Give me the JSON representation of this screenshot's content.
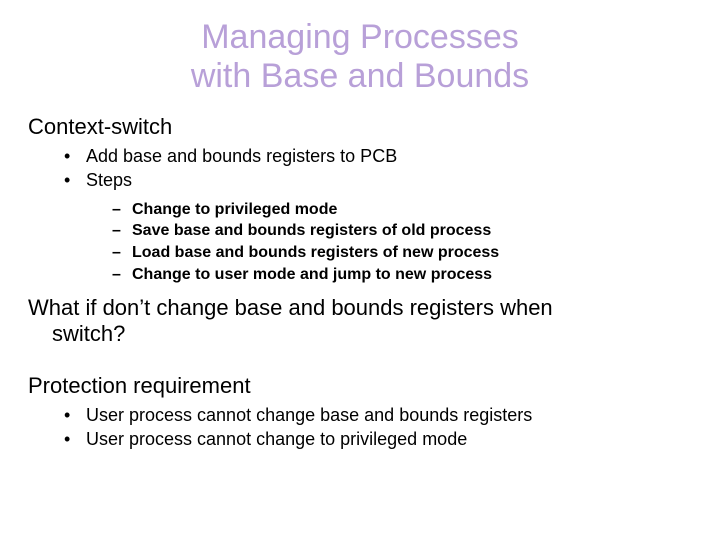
{
  "title_line1": "Managing Processes",
  "title_line2": "with Base and Bounds",
  "section1": "Context-switch",
  "b1": {
    "i1": "Add base and bounds registers to PCB",
    "i2": "Steps"
  },
  "d1": {
    "i1": "Change to privileged mode",
    "i2": "Save base and bounds registers of old process",
    "i3": "Load base and bounds registers of new process",
    "i4": "Change to user mode and jump to new process"
  },
  "question_l1": "What if don’t change base and bounds registers when",
  "question_l2": "switch?",
  "section2": "Protection requirement",
  "b2": {
    "i1": "User process cannot change base and bounds registers",
    "i2": "User process cannot change to privileged mode"
  }
}
